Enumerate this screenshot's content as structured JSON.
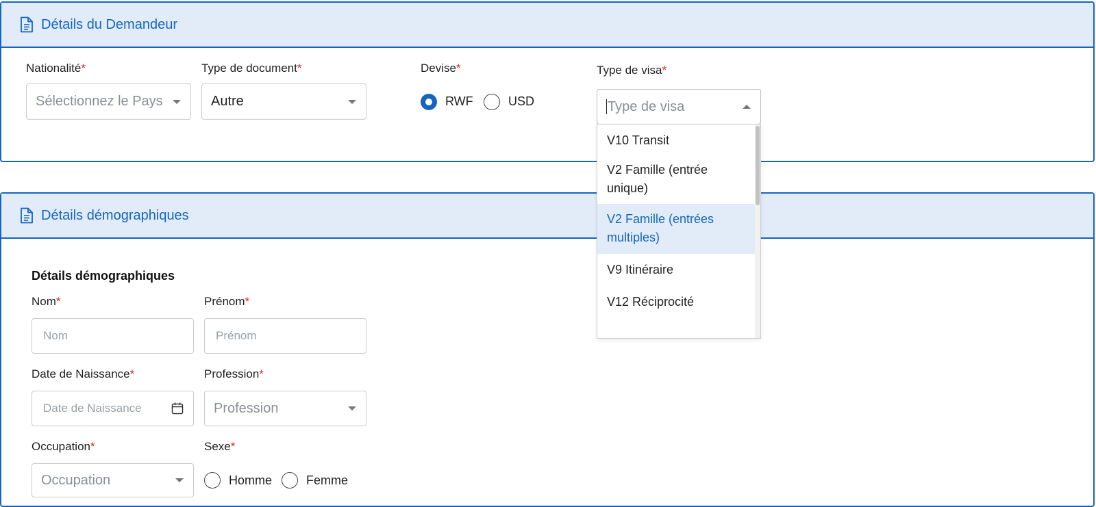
{
  "section1": {
    "title": "Détails du Demandeur",
    "nationality": {
      "label": "Nationalité",
      "required": "*",
      "placeholder": "Sélectionnez le Pays"
    },
    "doc_type": {
      "label": "Type de document",
      "required": "*",
      "value": "Autre"
    },
    "currency": {
      "label": "Devise",
      "required": "*",
      "options": [
        "RWF",
        "USD"
      ],
      "selected": "RWF"
    },
    "visa_type": {
      "label": "Type de visa",
      "required": "*",
      "placeholder": "Type de visa",
      "options": [
        "V10 Transit",
        "V2 Famille  (entrée unique)",
        "V2 Famille (entrées multiples)",
        "V9 Itinéraire",
        "V12 Réciprocité"
      ],
      "highlighted": "V2 Famille (entrées multiples)"
    }
  },
  "section2": {
    "title": "Détails démographiques",
    "subheading": "Détails démographiques",
    "nom": {
      "label": "Nom",
      "required": "*",
      "placeholder": "Nom"
    },
    "prenom": {
      "label": "Prénom",
      "required": "*",
      "placeholder": "Prénom"
    },
    "dob": {
      "label": "Date de Naissance",
      "required": "*",
      "placeholder": "Date de Naissance"
    },
    "profession": {
      "label": "Profession",
      "required": "*",
      "placeholder": "Profession"
    },
    "occupation": {
      "label": "Occupation",
      "required": "*",
      "placeholder": "Occupation"
    },
    "sexe": {
      "label": "Sexe",
      "required": "*",
      "options": [
        "Homme",
        "Femme"
      ]
    }
  },
  "colors": {
    "accent": "#1565c0",
    "header_bg": "#e1ecf8",
    "required": "#e02424"
  }
}
